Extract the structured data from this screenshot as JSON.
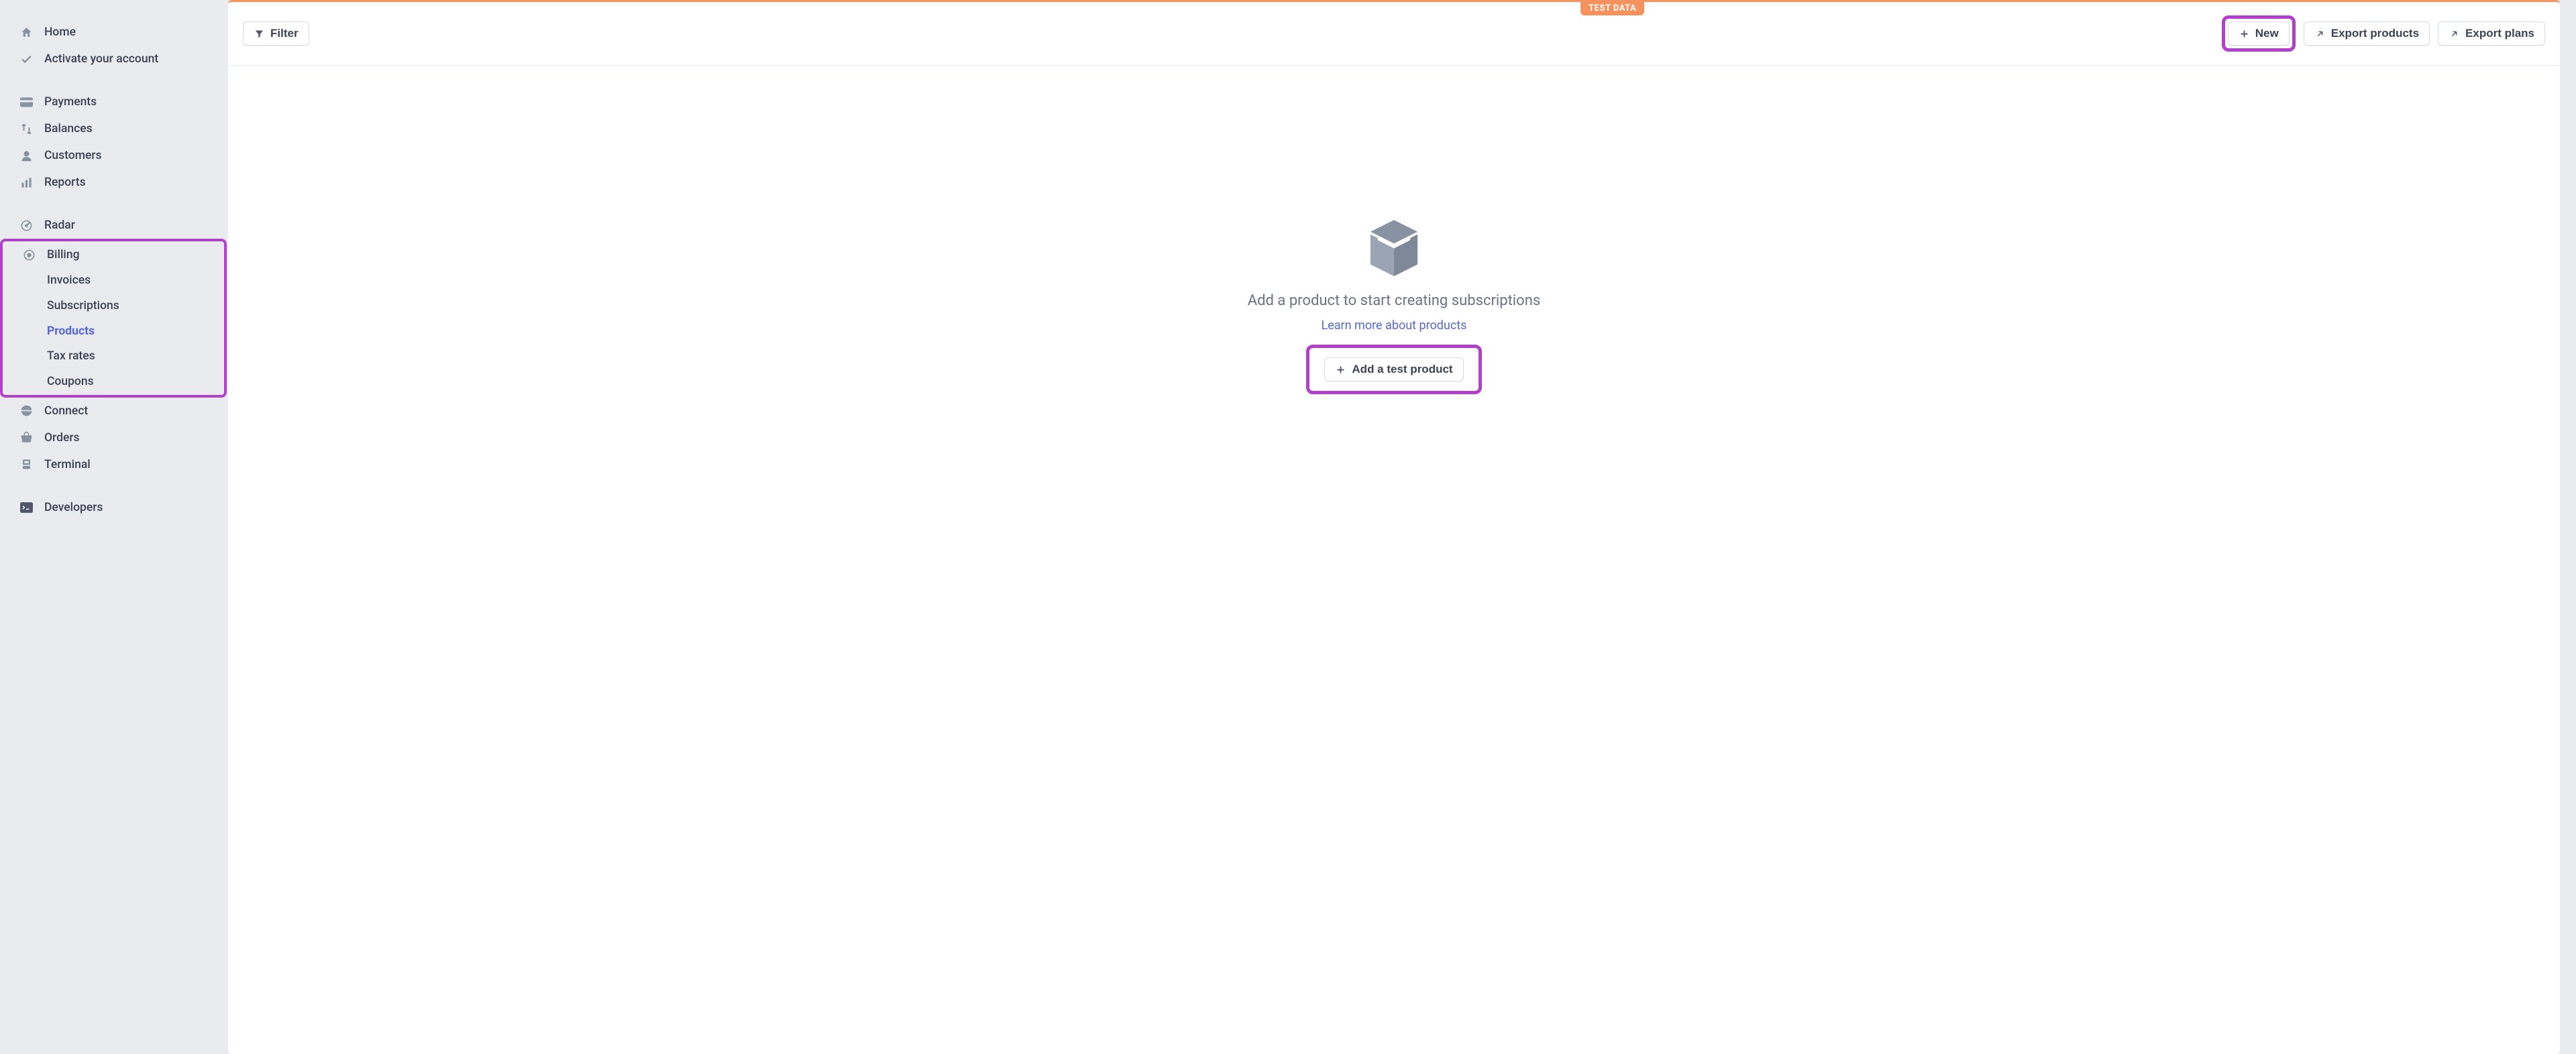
{
  "test_badge": "TEST DATA",
  "toolbar": {
    "filter_label": "Filter",
    "new_label": "New",
    "export_products_label": "Export products",
    "export_plans_label": "Export plans"
  },
  "sidebar": {
    "home": "Home",
    "activate": "Activate your account",
    "payments": "Payments",
    "balances": "Balances",
    "customers": "Customers",
    "reports": "Reports",
    "radar": "Radar",
    "billing": "Billing",
    "billing_items": {
      "invoices": "Invoices",
      "subscriptions": "Subscriptions",
      "products": "Products",
      "tax_rates": "Tax rates",
      "coupons": "Coupons"
    },
    "connect": "Connect",
    "orders": "Orders",
    "terminal": "Terminal",
    "developers": "Developers"
  },
  "empty": {
    "title": "Add a product to start creating subscriptions",
    "learn_more": "Learn more about products",
    "add_button": "Add a test product"
  }
}
